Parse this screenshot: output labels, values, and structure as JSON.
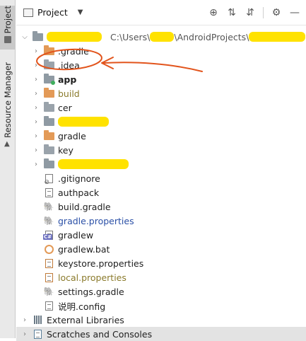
{
  "strip": {
    "project_tab": "Project",
    "resource_tab": "Resource Manager"
  },
  "header": {
    "title": "Project"
  },
  "tree": {
    "root_path": "C:\\Users\\",
    "root_path_tail": "\\AndroidProjects\\",
    "items": [
      {
        "label": ".gradle"
      },
      {
        "label": ".idea"
      },
      {
        "label": "app"
      },
      {
        "label": "build"
      },
      {
        "label": "cer"
      },
      {
        "label": ""
      },
      {
        "label": "gradle"
      },
      {
        "label": "key"
      },
      {
        "label": ""
      },
      {
        "label": ".gitignore"
      },
      {
        "label": "authpack"
      },
      {
        "label": "build.gradle"
      },
      {
        "label": "gradle.properties"
      },
      {
        "label": "gradlew"
      },
      {
        "label": "gradlew.bat"
      },
      {
        "label": "keystore.properties"
      },
      {
        "label": "local.properties"
      },
      {
        "label": "settings.gradle"
      },
      {
        "label": "说明.config"
      }
    ],
    "external_libraries": "External Libraries",
    "scratches": "Scratches and Consoles"
  },
  "colors": {
    "highlight": "#ffe200",
    "annotation": "#e2541c",
    "folder_orange": "#e39a57"
  }
}
